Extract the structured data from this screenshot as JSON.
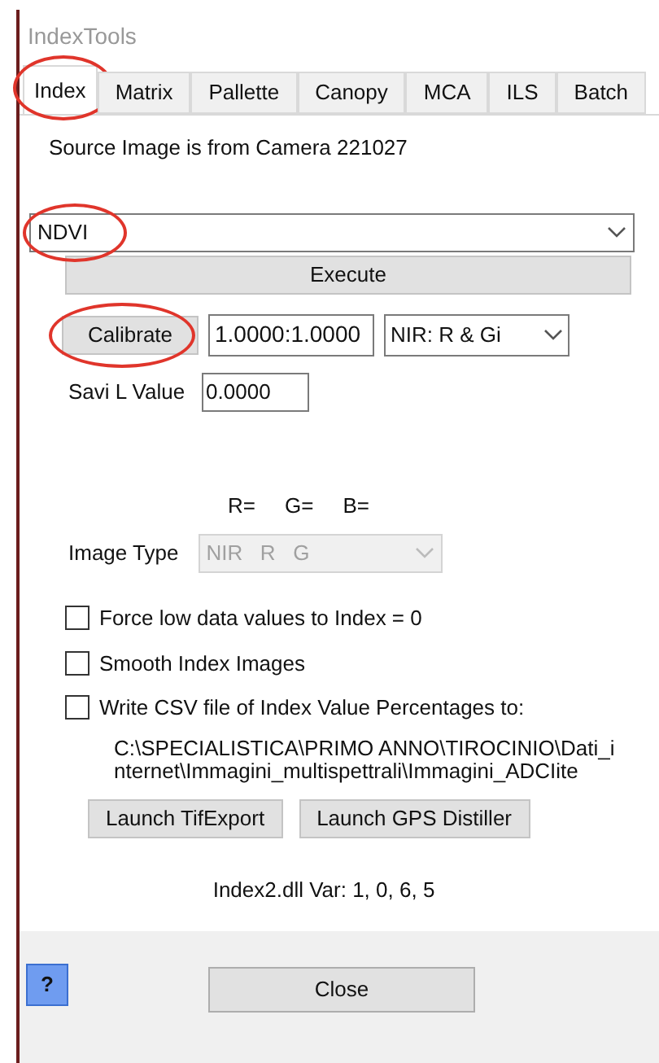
{
  "window": {
    "title": "IndexTools"
  },
  "tabs": [
    {
      "label": "Index",
      "selected": true,
      "circled": true
    },
    {
      "label": "Matrix",
      "selected": false,
      "circled": false
    },
    {
      "label": "Pallette",
      "selected": false,
      "circled": false
    },
    {
      "label": "Canopy",
      "selected": false,
      "circled": false
    },
    {
      "label": "MCA",
      "selected": false,
      "circled": false
    },
    {
      "label": "ILS",
      "selected": false,
      "circled": false
    },
    {
      "label": "Batch",
      "selected": false,
      "circled": false
    }
  ],
  "source_text": "Source Image is from Camera 221027",
  "index_dropdown": {
    "value": "NDVI",
    "circled": true
  },
  "execute_button": "Execute",
  "calibrate_button": {
    "label": "Calibrate",
    "circled": true
  },
  "calibration_field": {
    "value": "1.0000:1.0000"
  },
  "channel_dropdown": {
    "value": "NIR: R & Gi"
  },
  "savi": {
    "label": "Savi L Value",
    "value": "0.0000"
  },
  "channel_headers": [
    "R=",
    "G=",
    "B="
  ],
  "image_type": {
    "label": "Image Type",
    "value": "NIR   R   G",
    "disabled": true
  },
  "options": [
    {
      "label": "Force low data values to Index = 0",
      "checked": false
    },
    {
      "label": "Smooth Index Images",
      "checked": false
    },
    {
      "label": "Write CSV file of Index Value Percentages to:",
      "checked": false
    }
  ],
  "csv_path": "C:\\SPECIALISTICA\\PRIMO ANNO\\TIROCINIO\\Dati_internet\\Immagini_multispettrali\\Immagini_ADCIite",
  "launch_buttons": [
    "Launch TifExport",
    "Launch GPS Distiller"
  ],
  "version": "Index2.dll  Var: 1, 0, 6, 5",
  "help_button": "?",
  "close_button": "Close"
}
